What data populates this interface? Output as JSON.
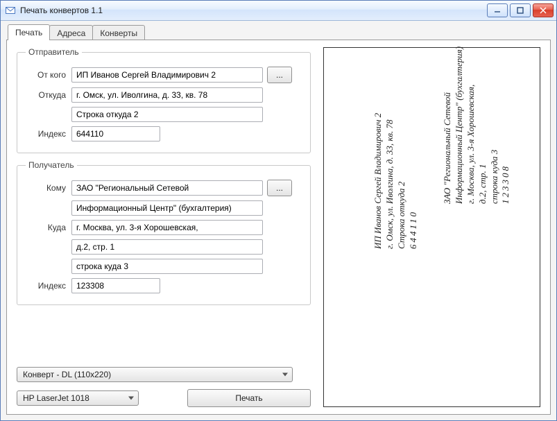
{
  "window": {
    "title": "Печать конвертов 1.1"
  },
  "tabs": {
    "print": "Печать",
    "addresses": "Адреса",
    "envelopes": "Конверты"
  },
  "sender": {
    "legend": "Отправитель",
    "from_label": "От кого",
    "from": "ИП Иванов Сергей Владимирович 2",
    "where_label": "Откуда",
    "where1": "г. Омск, ул. Иволгина, д. 33, кв. 78",
    "where2": "Строка откуда 2",
    "index_label": "Индекс",
    "index": "644110"
  },
  "recipient": {
    "legend": "Получатель",
    "to_label": "Кому",
    "to1": "ЗАО \"Региональный Сетевой",
    "to2": "Информационный Центр\" (бухгалтерия)",
    "where_label": "Куда",
    "where1": "г. Москва, ул. 3-я Хорошевская,",
    "where2": "д.2, стр. 1",
    "where3": "строка куда 3",
    "index_label": "Индекс",
    "index": "123308"
  },
  "envelope_select": "Конверт - DL (110x220)",
  "printer_select": "HP LaserJet 1018",
  "print_button": "Печать",
  "browse": "...",
  "preview": {
    "sender_line1": "ИП Иванов Сергей Владимирович 2",
    "sender_line2": "г. Омск, ул. Иволгина, д. 33, кв. 78",
    "sender_line3": "Строка откуда 2",
    "sender_index": "644110",
    "recip_line1": "ЗАО \"Региональный Сетевой",
    "recip_line2": "Информационный Центр\" (бухгалтерия)",
    "recip_line3": "г. Москва, ул. 3-я Хорошевская,",
    "recip_line4": "д.2, стр. 1",
    "recip_line5": "строка куда 3",
    "recip_index": "123308"
  }
}
